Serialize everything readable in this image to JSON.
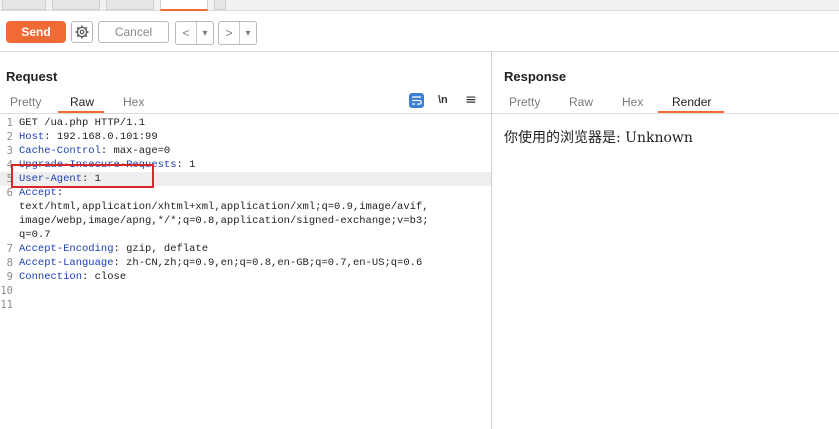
{
  "toolbar": {
    "send_label": "Send",
    "cancel_label": "Cancel",
    "back_arrow": "<",
    "forward_arrow": ">",
    "dropdown_caret": "▾"
  },
  "request": {
    "title": "Request",
    "tabs": [
      "Pretty",
      "Raw",
      "Hex"
    ],
    "active_tab": "Raw",
    "newline_toggle": "\\n",
    "menu_glyph": "≡",
    "lines": [
      {
        "num": "1",
        "key": "",
        "rest": "GET /ua.php HTTP/1.1"
      },
      {
        "num": "2",
        "key": "Host",
        "rest": ": 192.168.0.101:99"
      },
      {
        "num": "3",
        "key": "Cache-Control",
        "rest": ": max-age=0"
      },
      {
        "num": "4",
        "key": "Upgrade-Insecure-Requests",
        "rest": ": 1"
      },
      {
        "num": "5",
        "key": "User-Agent",
        "rest": ": 1"
      },
      {
        "num": "6",
        "key": "Accept",
        "rest": ":"
      },
      {
        "num": "",
        "key": "",
        "rest": "text/html,application/xhtml+xml,application/xml;q=0.9,image/avif,"
      },
      {
        "num": "",
        "key": "",
        "rest": "image/webp,image/apng,*/*;q=0.8,application/signed-exchange;v=b3;"
      },
      {
        "num": "",
        "key": "",
        "rest": "q=0.7"
      },
      {
        "num": "7",
        "key": "Accept-Encoding",
        "rest": ": gzip, deflate"
      },
      {
        "num": "8",
        "key": "Accept-Language",
        "rest": ": zh-CN,zh;q=0.9,en;q=0.8,en-GB;q=0.7,en-US;q=0.6"
      },
      {
        "num": "9",
        "key": "Connection",
        "rest": ": close"
      },
      {
        "num": "10",
        "key": "",
        "rest": ""
      },
      {
        "num": "11",
        "key": "",
        "rest": ""
      }
    ]
  },
  "response": {
    "title": "Response",
    "tabs": [
      "Pretty",
      "Raw",
      "Hex",
      "Render"
    ],
    "active_tab": "Render",
    "render_text": "你使用的浏览器是: Unknown"
  },
  "colors": {
    "accent": "#f06a35",
    "highlight_box": "#d9262a",
    "header_key": "#1a3fb6"
  },
  "icons": {
    "settings": "gear-icon",
    "wrap": "wrap-lines-icon",
    "menu": "hamburger-menu-icon"
  }
}
